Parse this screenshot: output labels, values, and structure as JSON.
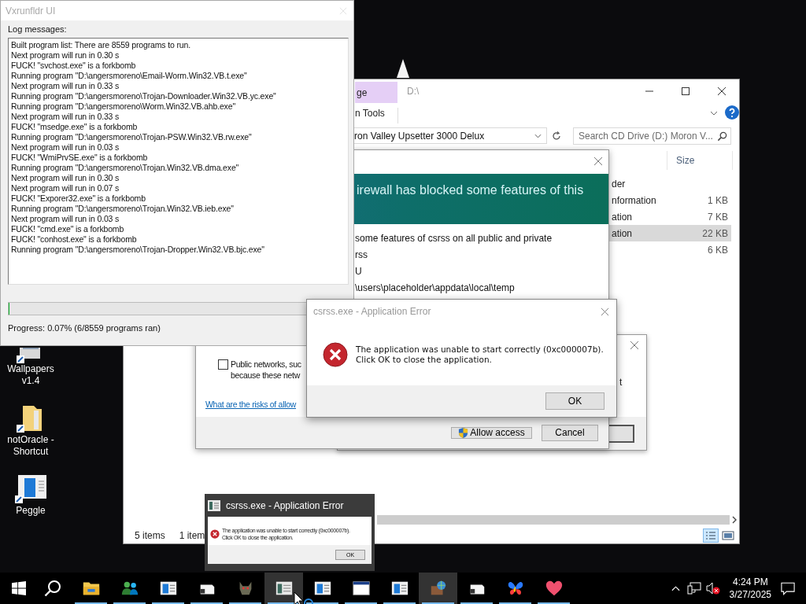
{
  "desktop_icons": [
    {
      "kind": "pictures",
      "label": "Wallpapers v1.4"
    },
    {
      "kind": "folder",
      "label": "notOracle - Shortcut"
    },
    {
      "kind": "app",
      "label": "Peggle"
    }
  ],
  "explorer": {
    "title": "D:\\",
    "context_tab": {
      "label": "ge",
      "selected": true
    },
    "context_group": "n Tools",
    "address": "ron Valley Upsetter 3000 Delux",
    "search": {
      "placeholder": "Search CD Drive (D:) Moron V..."
    },
    "columns": [
      {
        "label": "Size"
      }
    ],
    "rows": [
      {
        "type": "der",
        "selected": false
      },
      {
        "type": "nformation",
        "size": "1 KB",
        "selected": false
      },
      {
        "type": "ation",
        "size": "7 KB",
        "selected": false
      },
      {
        "type": "ation",
        "size": "22 KB",
        "selected": true
      },
      {
        "size": "6 KB",
        "selected": false
      }
    ],
    "status": [
      "5 items",
      "1 item"
    ]
  },
  "back_dialog": {
    "text": "t"
  },
  "firewall_dialog": {
    "heading": "irewall has blocked some features of this",
    "lines": [
      "some features of csrss on all public and private",
      "rss",
      "U",
      "\\users\\placeholder\\appdata\\local\\temp"
    ],
    "public_networks": {
      "checked": false,
      "lines": [
        "Public networks, suc",
        "because these netw"
      ]
    },
    "link": "What are the risks of allow",
    "buttons": [
      {
        "kind": "shield",
        "label": "Allow access"
      },
      {
        "kind": "plain",
        "label": "Cancel"
      }
    ]
  },
  "log_window": {
    "title": "Vxrunfldr UI",
    "label": "Log messages:",
    "lines": [
      "Built program list: There are 8559 programs to run.",
      "Next program will run in 0.30 s",
      "FUCK! \"svchost.exe\" is a forkbomb",
      "Running program \"D:\\angersmoreno\\Email-Worm.Win32.VB.t.exe\"",
      "Next program will run in 0.33 s",
      "Running program \"D:\\angersmoreno\\Trojan-Downloader.Win32.VB.yc.exe\"",
      "Running program \"D:\\angersmoreno\\Worm.Win32.VB.ahb.exe\"",
      "Next program will run in 0.33 s",
      "FUCK! \"msedge.exe\" is a forkbomb",
      "Running program \"D:\\angersmoreno\\Trojan-PSW.Win32.VB.rw.exe\"",
      "Next program will run in 0.03 s",
      "FUCK! \"WmiPrvSE.exe\" is a forkbomb",
      "Running program \"D:\\angersmoreno\\Trojan.Win32.VB.dma.exe\"",
      "Next program will run in 0.30 s",
      "Next program will run in 0.07 s",
      "FUCK! \"Exporer32.exe\" is a forkbomb",
      "Running program \"D:\\angersmoreno\\Trojan.Win32.VB.ieb.exe\"",
      "Next program will run in 0.03 s",
      "FUCK! \"cmd.exe\" is a forkbomb",
      "FUCK! \"conhost.exe\" is a forkbomb",
      "Running program \"D:\\angersmoreno\\Trojan-Dropper.Win32.VB.bjc.exe\""
    ],
    "progress": {
      "level": 0.0007,
      "text": "Progress: 0.07% (6/8559 programs ran)"
    }
  },
  "error_dialog": {
    "title": "csrss.exe - Application Error",
    "lines": [
      "The application was unable to start correctly (0xc000007b).",
      "Click OK to close the application."
    ],
    "button": "OK"
  },
  "taskbar_preview": {
    "title": "csrss.exe - Application Error",
    "lines": [
      "The application was unable to start correctly (0xc000007b).",
      "Click OK to close the application."
    ],
    "button": "OK"
  },
  "taskbar": {
    "apps": [
      {
        "kind": "folder",
        "active": false
      },
      {
        "kind": "people",
        "active": false
      },
      {
        "kind": "window",
        "active": false
      },
      {
        "kind": "file",
        "active": false
      },
      {
        "kind": "monster",
        "active": false
      },
      {
        "kind": "dialog",
        "active": true
      },
      {
        "kind": "window",
        "active": false
      },
      {
        "kind": "browser",
        "active": false
      },
      {
        "kind": "window",
        "active": false
      },
      {
        "kind": "globe",
        "active": true
      },
      {
        "kind": "file",
        "active": false
      },
      {
        "kind": "butterfly",
        "active": false
      },
      {
        "kind": "heart",
        "active": false
      }
    ],
    "time": "4:24 PM",
    "date": "3/27/2025"
  }
}
